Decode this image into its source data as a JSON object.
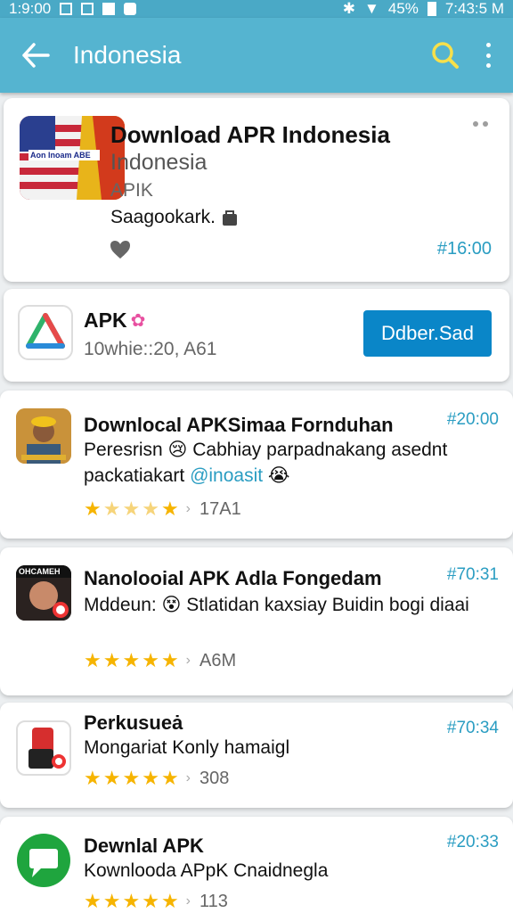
{
  "status": {
    "left": "1:9:00",
    "battery": "45%",
    "time": "7:43:5 M"
  },
  "appbar": {
    "title": "Indonesia"
  },
  "featured": {
    "name": "Download APR Indonesia",
    "subtitle": "Indonesia",
    "kind": "APIK",
    "desc": "Saagookark.",
    "time": "#16:00",
    "icon_text": "Aon Inoam ABE"
  },
  "apk_card": {
    "name": "APK",
    "meta": "10whie::20, A61",
    "button": "Ddber.Sad"
  },
  "items": [
    {
      "title": "Downlocal APKSimaa Fornduhan",
      "time": "#20:00",
      "desc_a": "Peresrisn 😢 Cabhiay parpadnakang asednt packatiakart ",
      "mention": "@inoasit",
      "desc_b": " 😭",
      "count": "17A1"
    },
    {
      "title": "Nanolooial APK Adla Fongedam",
      "time": "#70:31",
      "desc_a": "Mddeun: 😵 Stlatidan kaxsiay Buidin bogi diaai",
      "count": "A6M",
      "icon_text": "OHCAMEH"
    },
    {
      "title": "Perkusueȧ",
      "time": "#70:34",
      "desc_a": "Mongariat Konly hamaigl",
      "count": "308"
    },
    {
      "title": "Dewnlal APK",
      "time": "#20:33",
      "desc_a": "Kownlooda APpK Cnaidnegla",
      "count": "113"
    }
  ],
  "colors": {
    "appbar": "#55b4d0",
    "accent": "#2a9dc2",
    "button": "#0a86c8",
    "star": "#f6b400"
  }
}
